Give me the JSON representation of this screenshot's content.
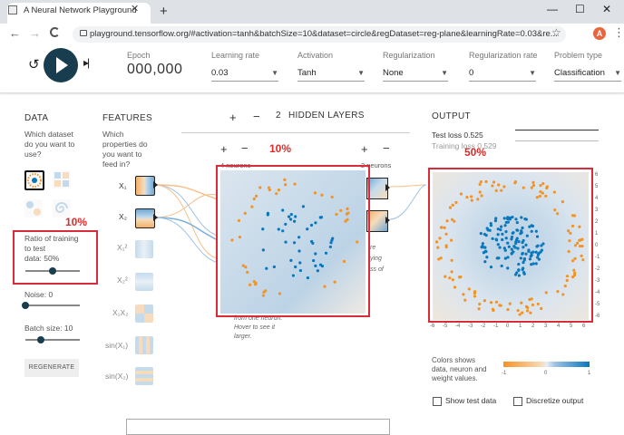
{
  "browser": {
    "tab_title": "A Neural Network Playground",
    "tab_close": "✕",
    "new_tab": "+",
    "url": "playground.tensorflow.org/#activation=tanh&batchSize=10&dataset=circle&regDataset=reg-plane&learningRate=0.03&re...",
    "profile_initial": "A",
    "back": "←",
    "forward": "→",
    "reload": "C",
    "star": "☆",
    "menu": "⋮",
    "minimize": "—",
    "maximize": "☐",
    "close": "✕"
  },
  "header": {
    "reset": "↺",
    "step": "▸|",
    "epoch_label": "Epoch",
    "epoch_value": "000,000",
    "learning_rate_label": "Learning rate",
    "learning_rate_value": "0.03",
    "activation_label": "Activation",
    "activation_value": "Tanh",
    "regularization_label": "Regularization",
    "regularization_value": "None",
    "reg_rate_label": "Regularization rate",
    "reg_rate_value": "0",
    "problem_type_label": "Problem type",
    "problem_type_value": "Classification",
    "caret": "▼"
  },
  "data_panel": {
    "title": "DATA",
    "question": [
      "Which dataset",
      "do you want to",
      "use?"
    ],
    "ratio_label": [
      "Ratio of training",
      "to test"
    ],
    "ratio_value_label": "data:  50%",
    "ratio_value": 0.5,
    "noise_label": "Noise:  0",
    "noise_value": 0.0,
    "batch_label": "Batch size:  10",
    "batch_value": 0.3,
    "regenerate": "REGENERATE"
  },
  "features_panel": {
    "title": "FEATURES",
    "question": [
      "Which",
      "properties do",
      "you want to",
      "feed in?"
    ],
    "items": [
      "X₁",
      "X₂",
      "X₁²",
      "X₂²",
      "X₁X₂",
      "sin(X₁)",
      "sin(X₂)"
    ]
  },
  "hidden": {
    "plus": "+",
    "minus": "−",
    "count": "2",
    "title": "HIDDEN LAYERS",
    "layer1_neurons": "4 neurons",
    "layer2_neurons": "2 neurons",
    "tooltip_tail": [
      "from one neuron.",
      "Hover to see it",
      "larger."
    ],
    "partial_right": [
      "re",
      "ying",
      "ss of"
    ]
  },
  "output": {
    "title": "OUTPUT",
    "test_loss": "Test loss 0.525",
    "training_loss": "Training loss 0.529",
    "x_ticks": [
      "-6",
      "-5",
      "-4",
      "-3",
      "-2",
      "-1",
      "0",
      "1",
      "2",
      "3",
      "4",
      "5",
      "6"
    ],
    "y_ticks": [
      "6",
      "5",
      "4",
      "3",
      "2",
      "1",
      "0",
      "-1",
      "-2",
      "-3",
      "-4",
      "-5",
      "-6"
    ],
    "legend_text": [
      "Colors shows",
      "data, neuron and",
      "weight values."
    ],
    "legend_ticks": [
      "-1",
      "0",
      "1"
    ],
    "show_test_data": "Show test data",
    "discretize_output": "Discretize output"
  },
  "annotations": {
    "ratio_percent": "10%",
    "neuron_percent": "10%",
    "output_percent": "50%"
  },
  "colors": {
    "orange": "#f59322",
    "blue": "#0877bd",
    "red_box": "#d92c3a",
    "play_button": "#183d4e"
  }
}
